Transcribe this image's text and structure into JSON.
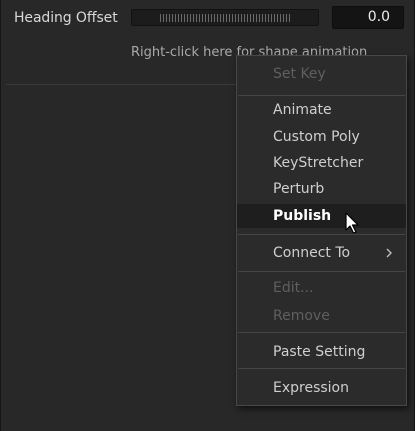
{
  "param": {
    "label": "Heading Offset",
    "value": "0.0",
    "hint": "Right-click here for shape animation"
  },
  "context_menu": {
    "items": [
      {
        "label": "Set Key",
        "enabled": false
      },
      {
        "label": "Animate",
        "enabled": true
      },
      {
        "label": "Custom Poly",
        "enabled": true
      },
      {
        "label": "KeyStretcher",
        "enabled": true
      },
      {
        "label": "Perturb",
        "enabled": true
      },
      {
        "label": "Publish",
        "enabled": true,
        "hovered": true
      },
      {
        "label": "Connect To",
        "enabled": true,
        "submenu": true
      },
      {
        "label": "Edit...",
        "enabled": false
      },
      {
        "label": "Remove",
        "enabled": false
      },
      {
        "label": "Paste Setting",
        "enabled": true
      },
      {
        "label": "Expression",
        "enabled": true
      }
    ]
  },
  "icons": {
    "submenu_arrow": "chevron-right-icon",
    "cursor": "mouse-pointer-icon"
  },
  "colors": {
    "panel_bg": "#282828",
    "menu_bg": "#2b2b2b",
    "highlight_bg": "#1e1e1e",
    "disabled_text": "#5f5f5f"
  }
}
